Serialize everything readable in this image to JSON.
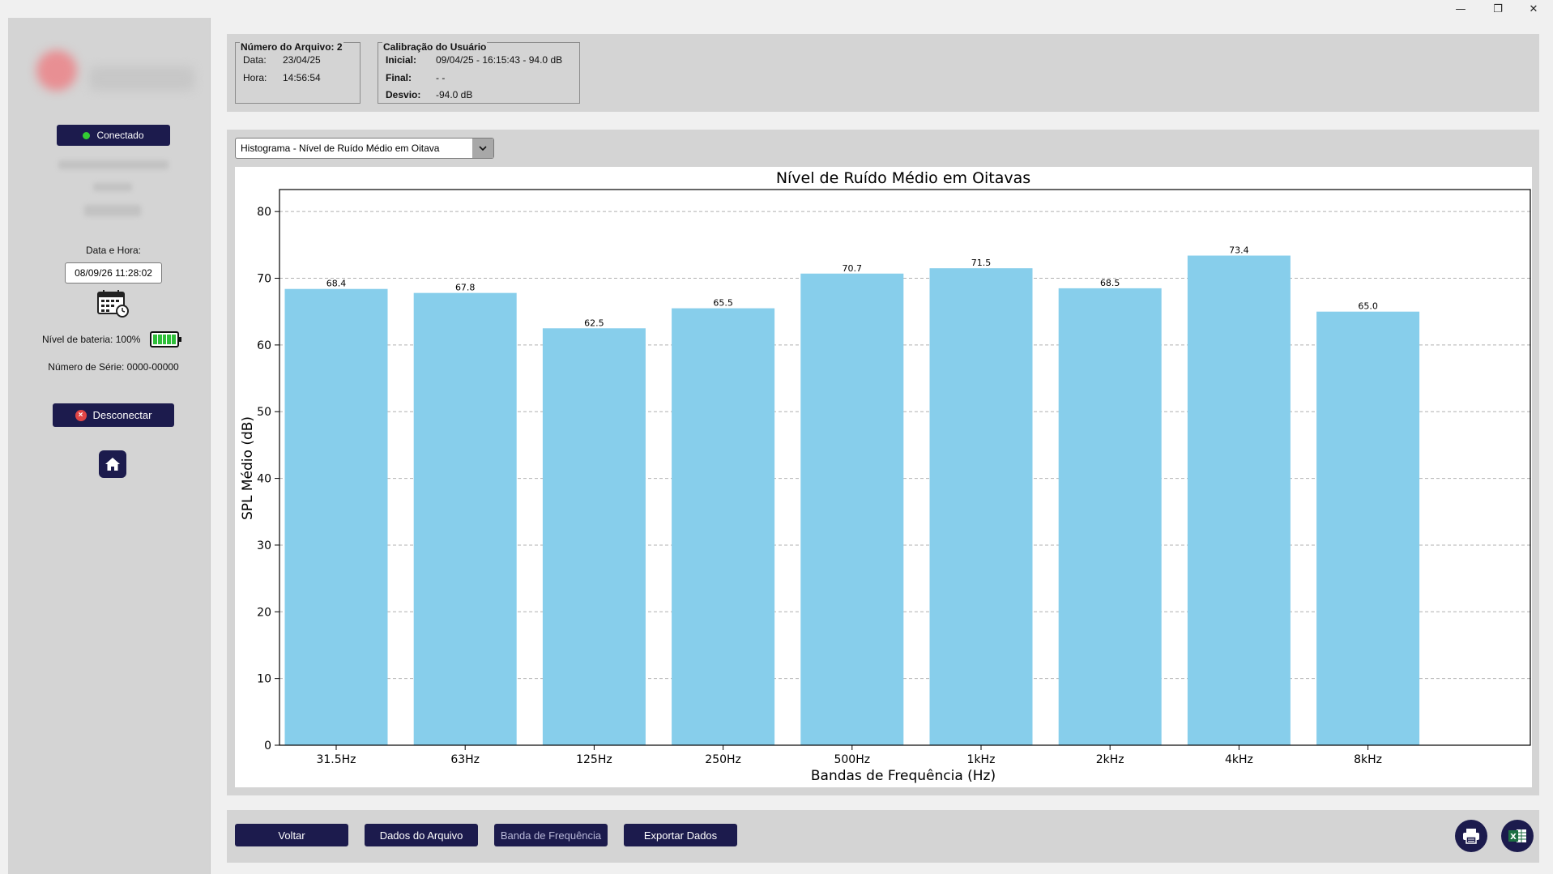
{
  "window": {
    "minimize_icon": "minimize-icon",
    "maximize_icon": "restore-icon",
    "close_icon": "close-icon"
  },
  "sidebar": {
    "status_label": "Conectado",
    "datetime_label": "Data e Hora:",
    "datetime_value": "08/09/26 11:28:02",
    "battery_label": "Nível de bateria: 100%",
    "battery_level": 1.0,
    "serial_label": "Número de Série: 0000-00000",
    "disconnect_label": "Desconectar",
    "calendar_icon": "calendar-clock-icon",
    "home_icon": "home-icon"
  },
  "file_info": {
    "title": "Número do Arquivo: 2",
    "date_label": "Data:",
    "date_value": "23/04/25",
    "time_label": "Hora:",
    "time_value": "14:56:54"
  },
  "calibration": {
    "title": "Calibração do Usuário",
    "initial_label": "Inicial:",
    "initial_value": "09/04/25 - 16:15:43 - 94.0 dB",
    "final_label": "Final:",
    "final_value": "- -",
    "deviation_label": "Desvio:",
    "deviation_value": "-94.0 dB"
  },
  "chart_selector": {
    "value": "Histograma - Nível de Ruído Médio em Oitava"
  },
  "chart_data": {
    "type": "bar",
    "title": "Nível de Ruído Médio em Oitavas",
    "xlabel": "Bandas de Frequência (Hz)",
    "ylabel": "SPL Médio (dB)",
    "categories": [
      "31.5Hz",
      "63Hz",
      "125Hz",
      "250Hz",
      "500Hz",
      "1kHz",
      "2kHz",
      "4kHz",
      "8kHz"
    ],
    "values": [
      68.4,
      67.8,
      62.5,
      65.5,
      70.7,
      71.5,
      68.5,
      73.4,
      65.0
    ],
    "value_labels": [
      "68.4",
      "67.8",
      "62.5",
      "65.5",
      "70.7",
      "71.5",
      "68.5",
      "73.4",
      "65.0"
    ],
    "ylim": [
      0,
      83.3
    ],
    "yticks": [
      "0",
      "10",
      "20",
      "30",
      "40",
      "50",
      "60",
      "70",
      "80"
    ],
    "grid": "horizontal dashed",
    "bar_color": "#87ceeb"
  },
  "bottom": {
    "back_label": "Voltar",
    "file_data_label": "Dados do Arquivo",
    "freq_band_label": "Banda de Frequência",
    "export_label": "Exportar Dados",
    "print_icon": "printer-icon",
    "excel_icon": "excel-icon"
  },
  "colors": {
    "button_bg": "#1c1b4d",
    "bar": "#87ceeb",
    "status_green": "#33cc33"
  }
}
